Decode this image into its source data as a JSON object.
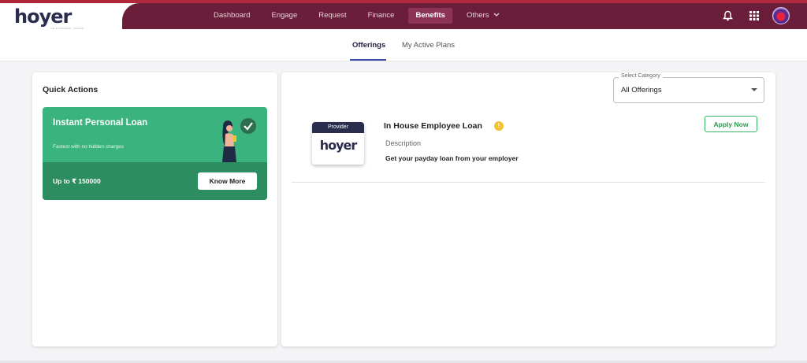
{
  "header": {
    "logo_text": "hoyer",
    "logo_sub": "AN EXTERNAL TEAMS",
    "nav": [
      {
        "label": "Dashboard"
      },
      {
        "label": "Engage"
      },
      {
        "label": "Request"
      },
      {
        "label": "Finance"
      },
      {
        "label": "Benefits",
        "active": true
      },
      {
        "label": "Others",
        "dropdown": true
      }
    ],
    "icons": [
      "bell-icon",
      "apps-grid-icon",
      "user-avatar"
    ],
    "colors": {
      "nav_band": "#6a1e3a",
      "accent_line": "#b0283a",
      "active_tab_bg": "#8c3355"
    }
  },
  "tabs": [
    {
      "label": "Offerings",
      "active": true
    },
    {
      "label": "My Active Plans"
    }
  ],
  "quick_actions": {
    "title": "Quick Actions",
    "promo": {
      "title": "Instant Personal Loan",
      "subtitle": "Fastest with no hidden charges",
      "amount": "Up to ₹ 150000",
      "button": "Know More",
      "colors": {
        "top": "#3bb37e",
        "bottom": "#2c8e60"
      }
    }
  },
  "offerings": {
    "select": {
      "label": "Select Category",
      "value": "All Offerings"
    },
    "items": [
      {
        "provider_label": "Provider",
        "provider_logo": "hoyer",
        "title": "In House Employee Loan",
        "info_icon": "info-icon",
        "description_label": "Description",
        "description": "Get your payday loan from your employer",
        "action": "Apply Now"
      }
    ]
  }
}
